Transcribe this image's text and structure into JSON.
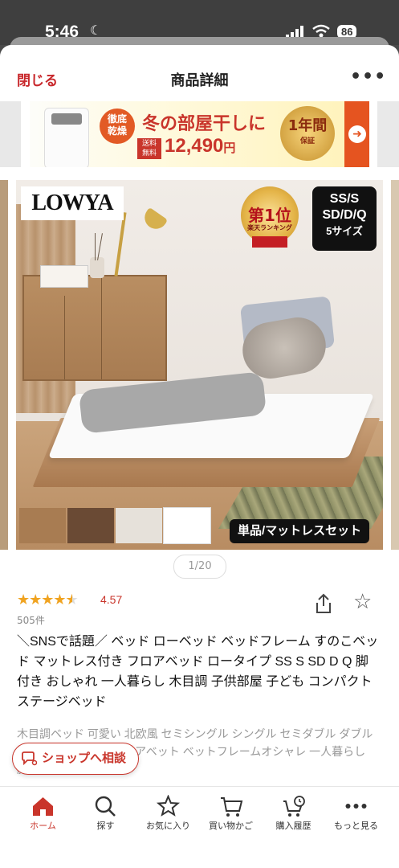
{
  "status_bar": {
    "time": "5:46",
    "battery": "86"
  },
  "nav": {
    "close_label": "閉じる",
    "title": "商品詳細",
    "more": "•••"
  },
  "banner": {
    "badge": "徹底\n乾燥",
    "headline": "冬の部屋干しに",
    "shipping": "送料\n無料",
    "price": "12,490",
    "price_unit": "円",
    "medal_main": "1年間",
    "medal_sub": "保証",
    "arrow_icon": "arrow-right-icon"
  },
  "gallery": {
    "brand": "LOWYA",
    "rank_main": "第1位",
    "rank_sub": "楽天ランキング",
    "sizes_line1": "SS/S",
    "sizes_line2": "SD/D/Q",
    "sizes_line3": "5サイズ",
    "set_label": "単品/マットレスセット",
    "swatch_colors": [
      "#a87c52",
      "#6a4a34",
      "#e6e1da",
      "#ffffff"
    ],
    "pager": "1/20"
  },
  "product": {
    "rating_value": 4.57,
    "rating_text": "4.57",
    "reviews": "505件",
    "title": "＼SNSで話題／ ベッド ローベッド ベッドフレーム すのこベッド マットレス付き フロアベッド ロータイプ SS S SD D Q 脚付き おしゃれ 一人暮らし 木目調 子供部屋 子ども コンパクト ステージベッド",
    "description": "木目調ベッド 可愛い 北欧風 セミシングル シングル セミダブル ダブル クイーン 和室にも フロアベット ベットフレームオシャレ 一人暮らし 脚付き シンプル deb"
  },
  "shop_button": {
    "label": "ショップへ相談"
  },
  "tabbar": [
    {
      "label": "ホーム",
      "icon": "home-icon",
      "active": true
    },
    {
      "label": "探す",
      "icon": "search-icon",
      "active": false
    },
    {
      "label": "お気に入り",
      "icon": "star-icon",
      "active": false
    },
    {
      "label": "買い物かご",
      "icon": "cart-icon",
      "active": false
    },
    {
      "label": "購入履歴",
      "icon": "history-cart-icon",
      "active": false
    },
    {
      "label": "もっと見る",
      "icon": "more-icon",
      "active": false
    }
  ],
  "colors": {
    "accent": "#c9352b",
    "star": "#f0a320"
  }
}
